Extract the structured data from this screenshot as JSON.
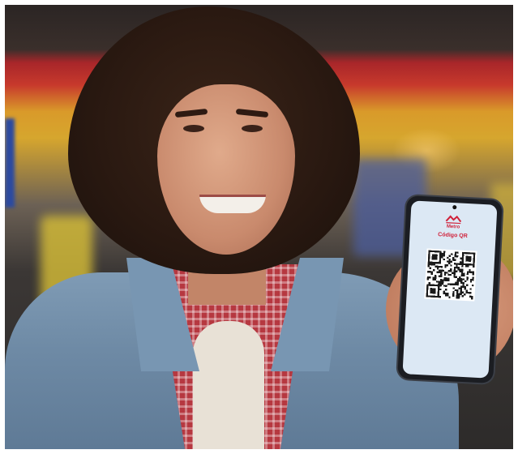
{
  "phone_screen": {
    "brand": "Metro",
    "title": "Código QR",
    "line1": "",
    "line2": "",
    "line3": "",
    "line4": "",
    "footer": ""
  },
  "colors": {
    "brand_red": "#d0213a",
    "screen_bg": "#dce8f4"
  },
  "icons": {
    "logo": "metro-logo-icon",
    "code": "qr-code-icon"
  }
}
